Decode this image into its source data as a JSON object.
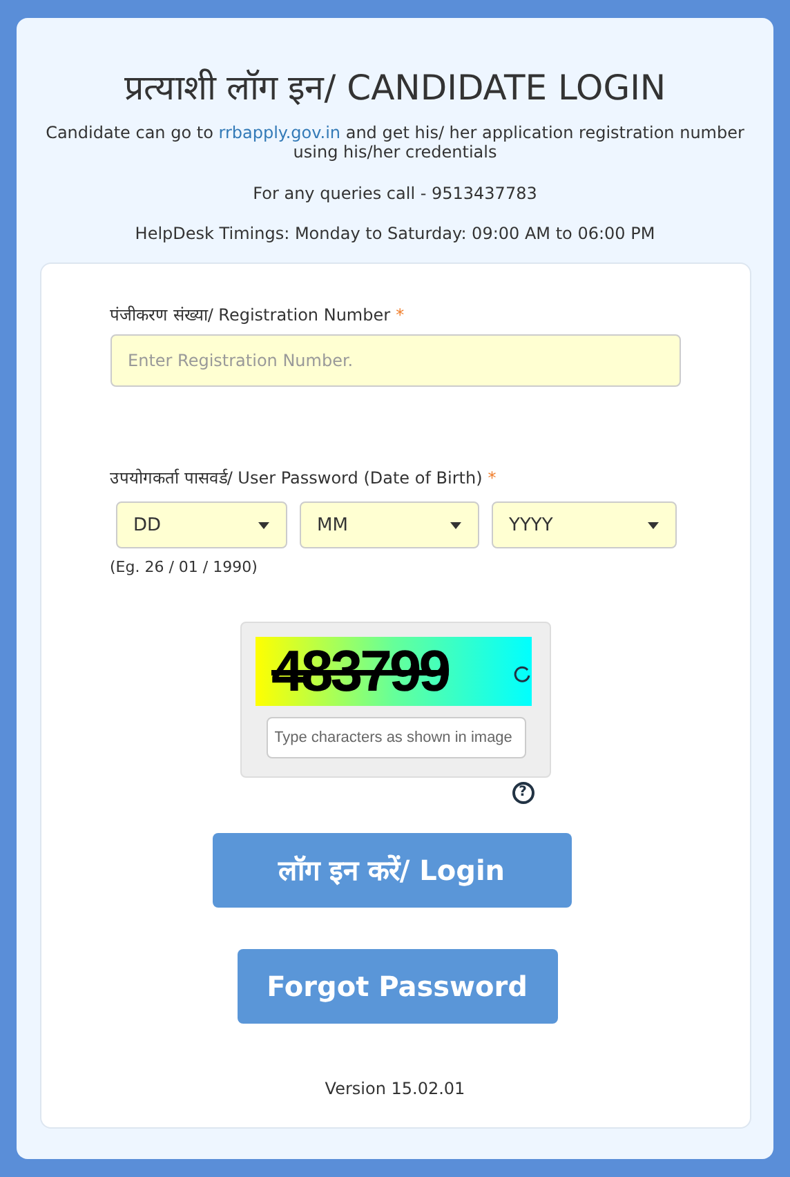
{
  "title": "प्रत्याशी लॉग इन/ CANDIDATE LOGIN",
  "info": {
    "before": "Candidate can go to ",
    "link": "rrbapply.gov.in",
    "after": " and get his/ her application registration number using his/her credentials"
  },
  "queries": "For any queries call - 9513437783",
  "timings": "HelpDesk Timings: Monday to Saturday: 09:00 AM to 06:00 PM",
  "registration": {
    "label": "पंजीकरण संख्या/ Registration Number",
    "required": "*",
    "placeholder": "Enter Registration Number."
  },
  "password": {
    "label": "उपयोगकर्ता पासवर्ड/ User Password (Date of Birth)",
    "required": "*",
    "selects": [
      "DD",
      "MM",
      "YYYY"
    ],
    "example": "(Eg. 26 / 01 / 1990)"
  },
  "captcha": {
    "text": "483799",
    "placeholder": "Type characters as shown in image",
    "help": "?"
  },
  "buttons": [
    "लॉग इन करें/ Login",
    "Forgot Password"
  ],
  "version": "Version 15.02.01"
}
